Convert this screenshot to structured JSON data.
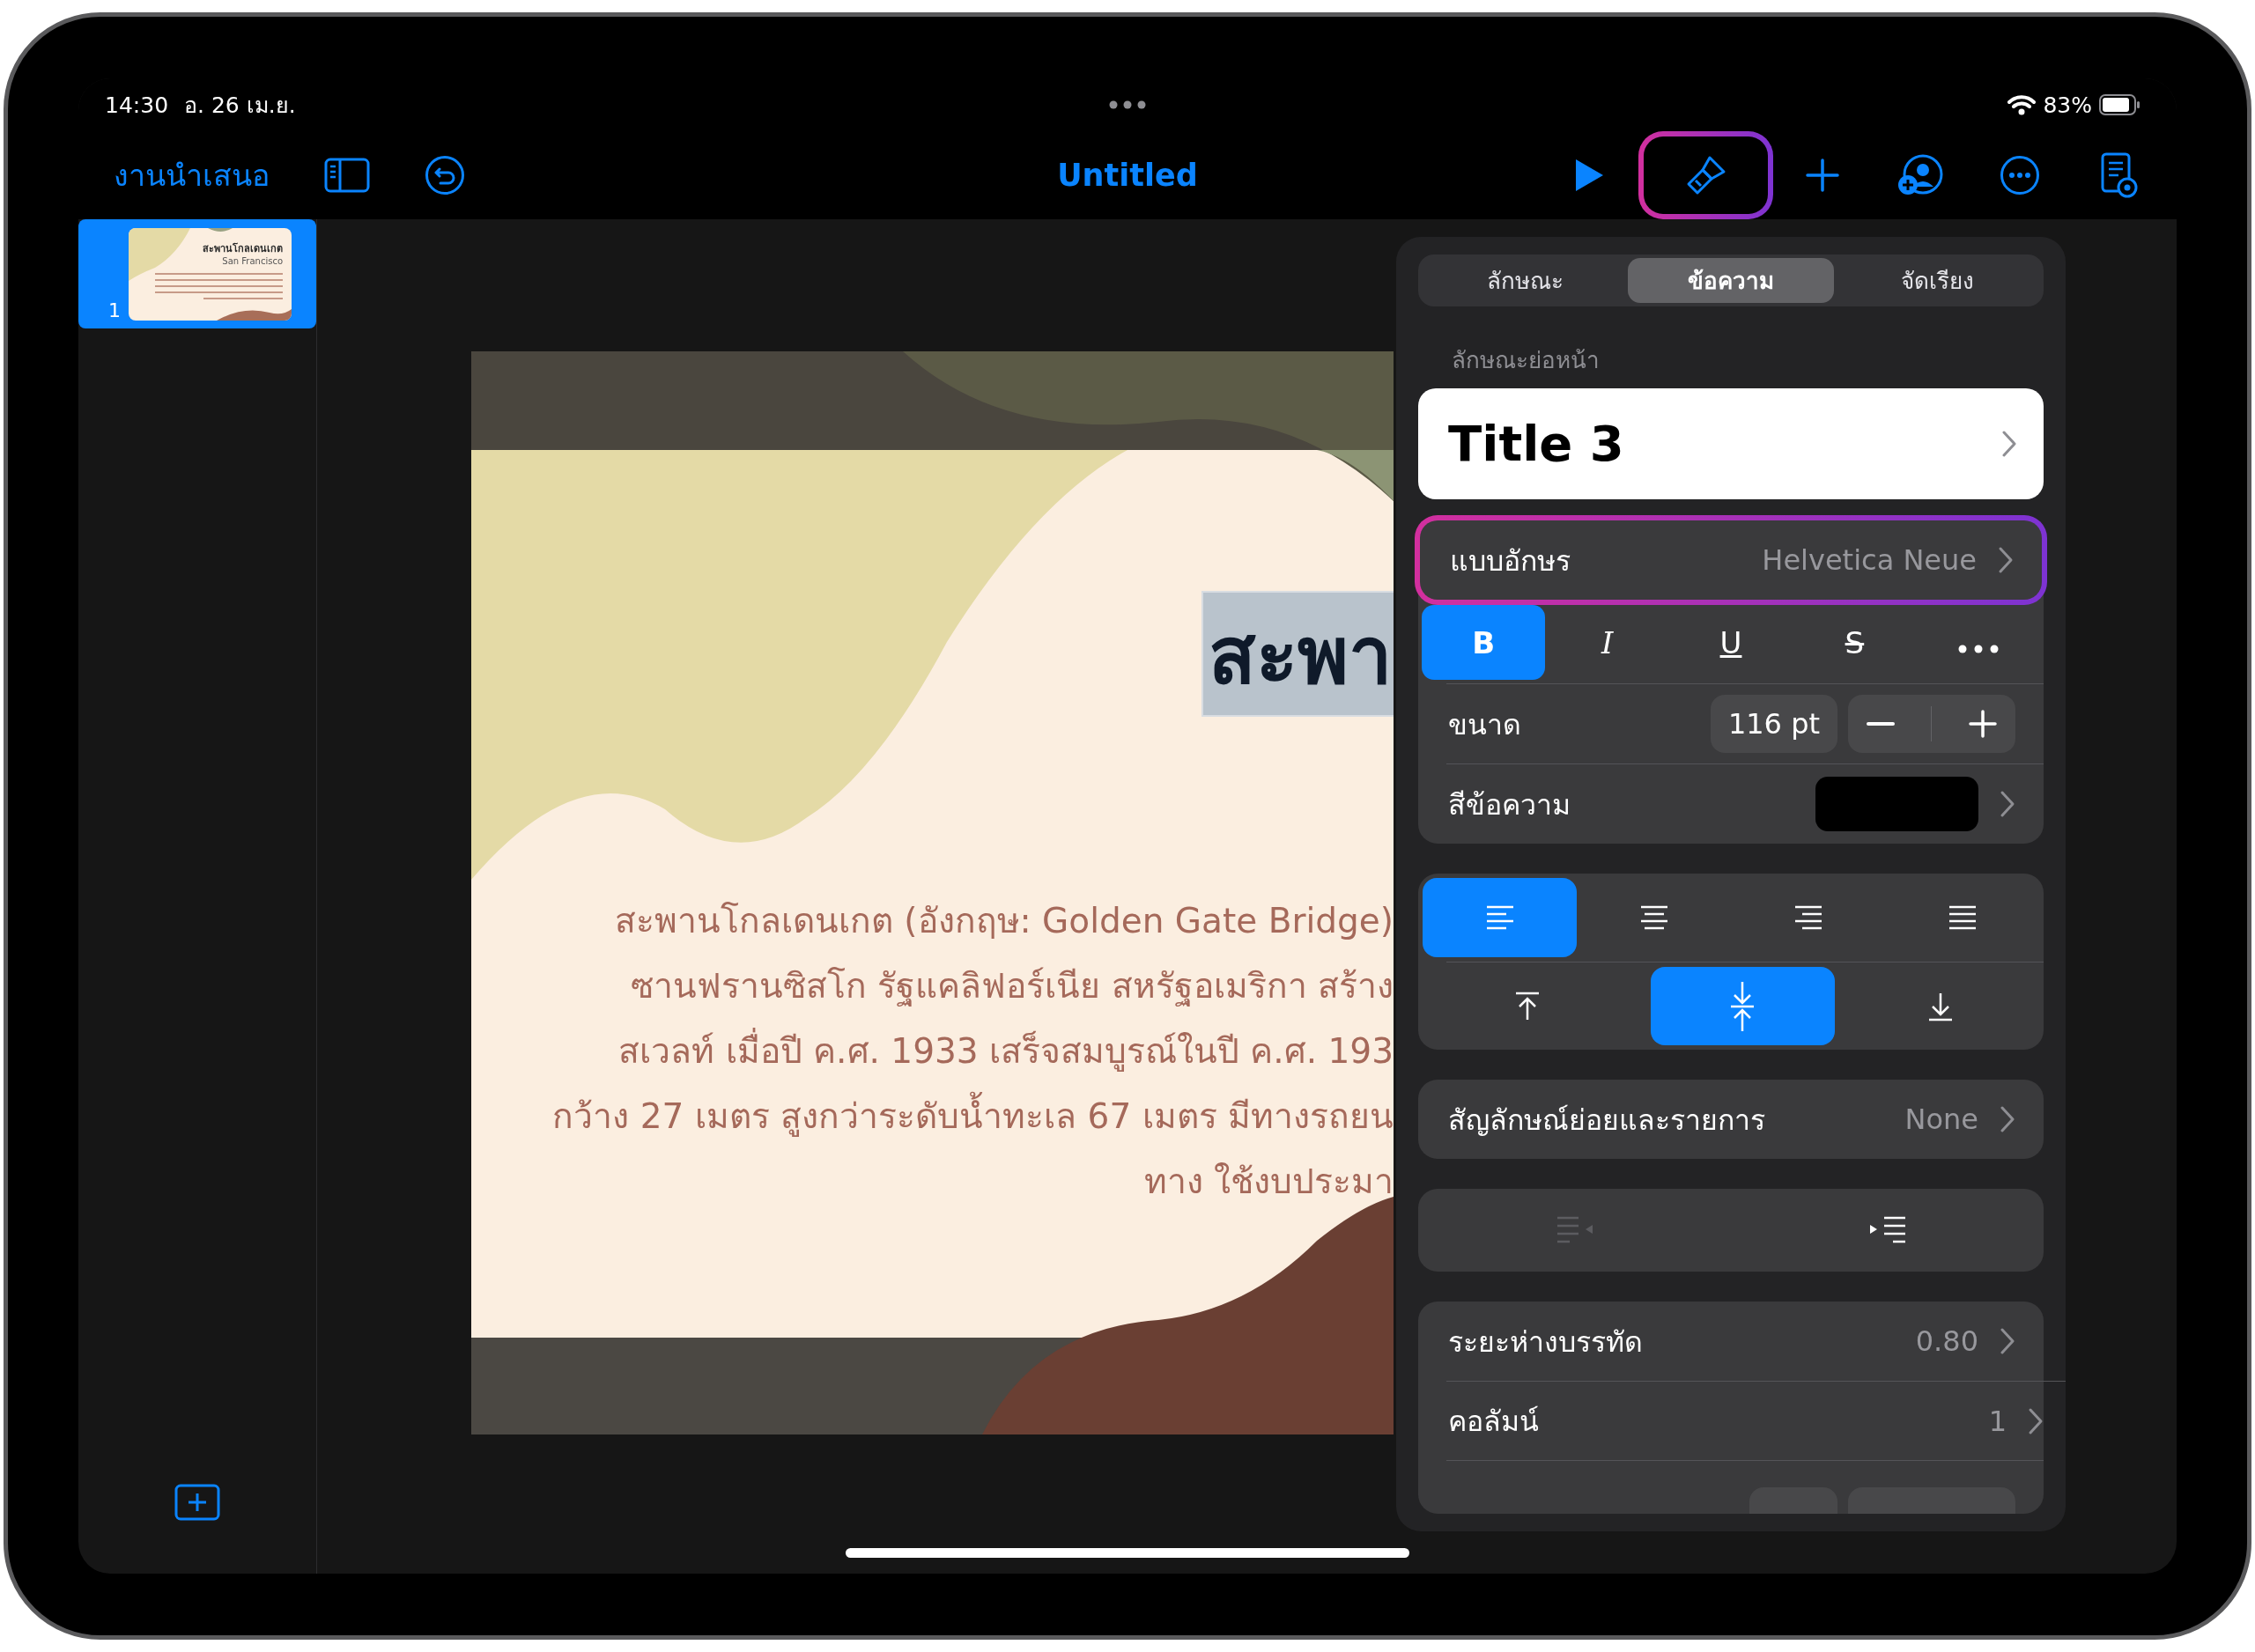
{
  "status_bar": {
    "time": "14:30",
    "date": "อ. 26 เม.ย.",
    "battery": "83%"
  },
  "toolbar": {
    "back_label": "งานนำเสนอ",
    "title": "Untitled",
    "left_tools": [
      {
        "kind": "sidebar"
      },
      {
        "kind": "undo"
      }
    ],
    "right_tools": [
      {
        "kind": "play",
        "highlighted": false
      },
      {
        "kind": "brush",
        "highlighted": true
      },
      {
        "kind": "add",
        "highlighted": false
      },
      {
        "kind": "collaborate",
        "highlighted": false
      },
      {
        "kind": "more",
        "highlighted": false
      },
      {
        "kind": "notes",
        "highlighted": false
      }
    ]
  },
  "slides": [
    {
      "number": "1",
      "selected": true,
      "title": "สะพานโกลเดนเกต",
      "subtitle": "San Francisco"
    }
  ],
  "slide": {
    "title": "สะพา",
    "body_lines": [
      "สะพานโกลเดนเกต (อังกฤษ: Golden Gate Bridge)",
      "ซานฟรานซิสโก รัฐแคลิฟอร์เนีย สหรัฐอเมริกา สร้าง",
      "สเวลท์ เมื่อปี ค.ศ. 1933 เสร็จสมบูรณ์ในปี ค.ศ. 193",
      "กว้าง 27 เมตร สูงกว่าระดับน้ำทะเล 67 เมตร มีทางรถยน",
      "ทาง ใช้งบประมา"
    ]
  },
  "panel": {
    "tabs": [
      {
        "label": "ลักษณะ",
        "selected": false
      },
      {
        "label": "ข้อความ",
        "selected": true
      },
      {
        "label": "จัดเรียง",
        "selected": false
      }
    ],
    "section_label": "ลักษณะย่อหน้า",
    "paragraph_style": "Title 3",
    "font": {
      "label": "แบบอักษร",
      "value": "Helvetica Neue",
      "highlighted": true
    },
    "styles": [
      {
        "kind": "bold",
        "label": "B",
        "selected": true
      },
      {
        "kind": "italic",
        "label": "I",
        "selected": false
      },
      {
        "kind": "underline",
        "label": "U",
        "selected": false
      },
      {
        "kind": "strike",
        "label": "S",
        "selected": false
      },
      {
        "kind": "more",
        "selected": false
      }
    ],
    "size": {
      "label": "ขนาด",
      "value": "116 pt"
    },
    "text_color": {
      "label": "สีข้อความ",
      "color": "#000000"
    },
    "alignment": [
      {
        "kind": "left",
        "selected": true
      },
      {
        "kind": "center",
        "selected": false
      },
      {
        "kind": "right",
        "selected": false
      },
      {
        "kind": "justify",
        "selected": false
      }
    ],
    "vertical": [
      {
        "kind": "top",
        "selected": false
      },
      {
        "kind": "middle",
        "selected": true
      },
      {
        "kind": "bottom",
        "selected": false
      }
    ],
    "bullets": {
      "label": "สัญลักษณ์ย่อยและรายการ",
      "value": "None"
    },
    "indent": [
      {
        "kind": "decrease",
        "disabled": true
      },
      {
        "kind": "increase",
        "disabled": false
      }
    ],
    "spacing": [
      {
        "label": "ระยะห่างบรรทัด",
        "value": "0.80"
      },
      {
        "label": "คอลัมน์",
        "value": "1"
      }
    ]
  }
}
